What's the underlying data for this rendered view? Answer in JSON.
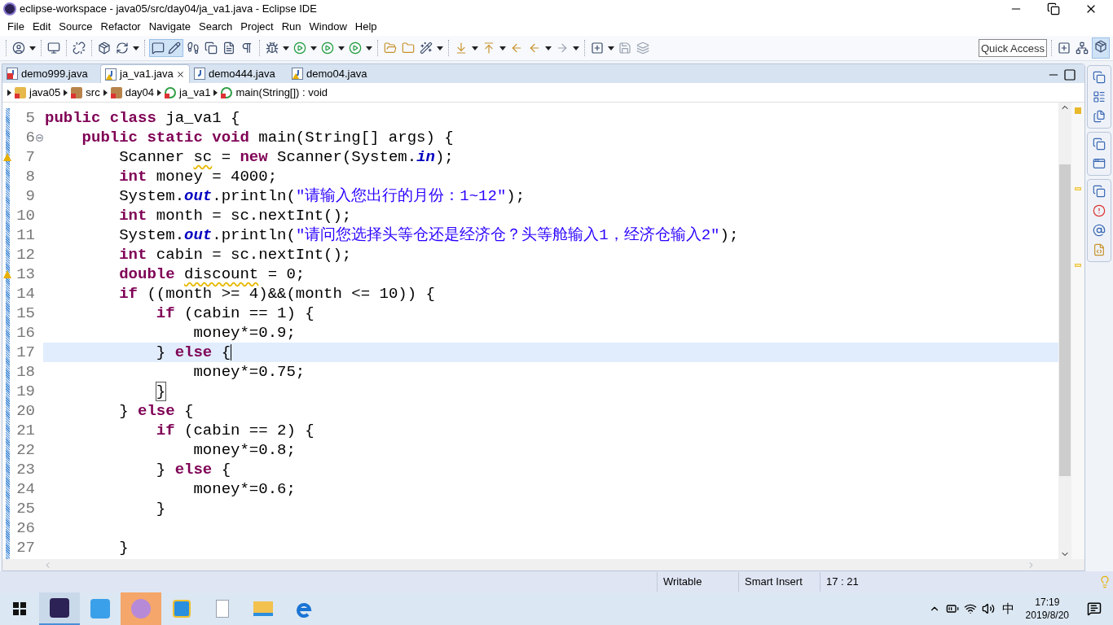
{
  "window": {
    "title": "eclipse-workspace - java05/src/day04/ja_va1.java - Eclipse IDE"
  },
  "menu": [
    "File",
    "Edit",
    "Source",
    "Refactor",
    "Navigate",
    "Search",
    "Project",
    "Run",
    "Window",
    "Help"
  ],
  "quick_access": {
    "placeholder": "Quick Access"
  },
  "tabs": [
    {
      "label": "demo999.java",
      "selected": false,
      "kind": "error"
    },
    {
      "label": "ja_va1.java",
      "selected": true,
      "kind": "warning"
    },
    {
      "label": "demo444.java",
      "selected": false,
      "kind": "plain"
    },
    {
      "label": "demo04.java",
      "selected": false,
      "kind": "warning"
    }
  ],
  "breadcrumb": [
    {
      "label": "java05",
      "kind": "project"
    },
    {
      "label": "src",
      "kind": "package-root"
    },
    {
      "label": "day04",
      "kind": "package"
    },
    {
      "label": "ja_va1",
      "kind": "class"
    },
    {
      "label": "main(String[]) : void",
      "kind": "method"
    }
  ],
  "lines": [
    {
      "number": "5",
      "current": false,
      "warning": false,
      "fold": false,
      "tokens": [
        {
          "text": "public class",
          "kind": "keyword"
        },
        {
          "text": " ja_va1 {",
          "kind": "plain"
        }
      ]
    },
    {
      "number": "6",
      "current": false,
      "warning": false,
      "fold": true,
      "tokens": [
        {
          "text": "    public static void",
          "kind": "keyword"
        },
        {
          "text": " main(String[] args) {",
          "kind": "plain"
        }
      ]
    },
    {
      "number": "7",
      "current": false,
      "warning": true,
      "fold": false,
      "tokens": [
        {
          "text": "        Scanner ",
          "kind": "plain"
        },
        {
          "text": "sc",
          "kind": "warning"
        },
        {
          "text": " = ",
          "kind": "plain"
        },
        {
          "text": "new",
          "kind": "keyword"
        },
        {
          "text": " Scanner(System.",
          "kind": "plain"
        },
        {
          "text": "in",
          "kind": "field"
        },
        {
          "text": ");",
          "kind": "plain"
        }
      ]
    },
    {
      "number": "8",
      "current": false,
      "warning": false,
      "fold": false,
      "tokens": [
        {
          "text": "        int",
          "kind": "keyword"
        },
        {
          "text": " money = 4000;",
          "kind": "plain"
        }
      ]
    },
    {
      "number": "9",
      "current": false,
      "warning": false,
      "fold": false,
      "tokens": [
        {
          "text": "        System.",
          "kind": "plain"
        },
        {
          "text": "out",
          "kind": "field"
        },
        {
          "text": ".println(",
          "kind": "plain"
        },
        {
          "text": "\"请输入您出行的月份：1~12\"",
          "kind": "string"
        },
        {
          "text": ");",
          "kind": "plain"
        }
      ]
    },
    {
      "number": "10",
      "current": false,
      "warning": false,
      "fold": false,
      "tokens": [
        {
          "text": "        int",
          "kind": "keyword"
        },
        {
          "text": " month = sc.nextInt();",
          "kind": "plain"
        }
      ]
    },
    {
      "number": "11",
      "current": false,
      "warning": false,
      "fold": false,
      "tokens": [
        {
          "text": "        System.",
          "kind": "plain"
        },
        {
          "text": "out",
          "kind": "field"
        },
        {
          "text": ".println(",
          "kind": "plain"
        },
        {
          "text": "\"请问您选择头等仓还是经济仓？头等舱输入1，经济仓输入2\"",
          "kind": "string"
        },
        {
          "text": ");",
          "kind": "plain"
        }
      ]
    },
    {
      "number": "12",
      "current": false,
      "warning": false,
      "fold": false,
      "tokens": [
        {
          "text": "        int",
          "kind": "keyword"
        },
        {
          "text": " cabin = sc.nextInt();",
          "kind": "plain"
        }
      ]
    },
    {
      "number": "13",
      "current": false,
      "warning": true,
      "fold": false,
      "tokens": [
        {
          "text": "        double ",
          "kind": "keyword"
        },
        {
          "text": "discount",
          "kind": "warning"
        },
        {
          "text": " = 0;",
          "kind": "plain"
        }
      ]
    },
    {
      "number": "14",
      "current": false,
      "warning": false,
      "fold": false,
      "tokens": [
        {
          "text": "        if",
          "kind": "keyword"
        },
        {
          "text": " ((month >= 4)&&(month <= 10)) {",
          "kind": "plain"
        }
      ]
    },
    {
      "number": "15",
      "current": false,
      "warning": false,
      "fold": false,
      "tokens": [
        {
          "text": "            if",
          "kind": "keyword"
        },
        {
          "text": " (cabin == 1) {",
          "kind": "plain"
        }
      ]
    },
    {
      "number": "16",
      "current": false,
      "warning": false,
      "fold": false,
      "tokens": [
        {
          "text": "                money*=0.9;",
          "kind": "plain"
        }
      ]
    },
    {
      "number": "17",
      "current": true,
      "warning": false,
      "fold": false,
      "tokens": [
        {
          "text": "            } ",
          "kind": "plain"
        },
        {
          "text": "else",
          "kind": "keyword"
        },
        {
          "text": " {",
          "kind": "plain"
        }
      ]
    },
    {
      "number": "18",
      "current": false,
      "warning": false,
      "fold": false,
      "tokens": [
        {
          "text": "                money*=0.75;",
          "kind": "plain"
        }
      ]
    },
    {
      "number": "19",
      "current": false,
      "warning": false,
      "fold": false,
      "tokens": [
        {
          "text": "            }",
          "kind": "bracket-match"
        }
      ]
    },
    {
      "number": "20",
      "current": false,
      "warning": false,
      "fold": false,
      "tokens": [
        {
          "text": "        } ",
          "kind": "plain"
        },
        {
          "text": "else",
          "kind": "keyword"
        },
        {
          "text": " {",
          "kind": "plain"
        }
      ]
    },
    {
      "number": "21",
      "current": false,
      "warning": false,
      "fold": false,
      "tokens": [
        {
          "text": "            if",
          "kind": "keyword"
        },
        {
          "text": " (cabin == 2) {",
          "kind": "plain"
        }
      ]
    },
    {
      "number": "22",
      "current": false,
      "warning": false,
      "fold": false,
      "tokens": [
        {
          "text": "                money*=0.8;",
          "kind": "plain"
        }
      ]
    },
    {
      "number": "23",
      "current": false,
      "warning": false,
      "fold": false,
      "tokens": [
        {
          "text": "            } ",
          "kind": "plain"
        },
        {
          "text": "else",
          "kind": "keyword"
        },
        {
          "text": " {",
          "kind": "plain"
        }
      ]
    },
    {
      "number": "24",
      "current": false,
      "warning": false,
      "fold": false,
      "tokens": [
        {
          "text": "                money*=0.6;",
          "kind": "plain"
        }
      ]
    },
    {
      "number": "25",
      "current": false,
      "warning": false,
      "fold": false,
      "tokens": [
        {
          "text": "            }",
          "kind": "plain"
        }
      ]
    },
    {
      "number": "26",
      "current": false,
      "warning": false,
      "fold": false
    },
    {
      "number": "27",
      "current": false,
      "warning": false,
      "fold": false,
      "tokens": [
        {
          "text": "        }",
          "kind": "plain"
        }
      ]
    }
  ],
  "status_bar": [
    "Writable",
    "Smart Insert",
    "17 : 21"
  ],
  "taskbar": {
    "ime": "中",
    "time": "17:19",
    "date": "2019/8/20"
  }
}
